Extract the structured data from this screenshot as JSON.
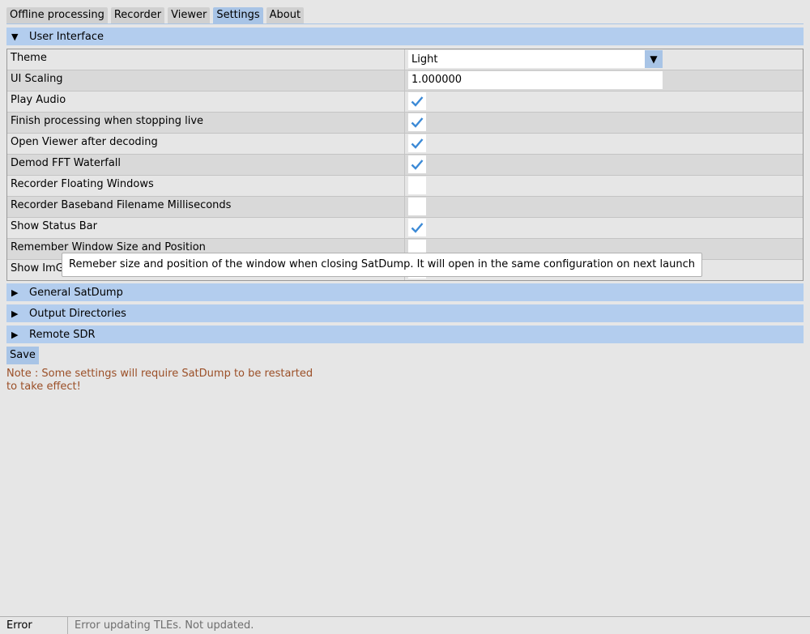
{
  "tabs": [
    {
      "label": "Offline processing",
      "active": false
    },
    {
      "label": "Recorder",
      "active": false
    },
    {
      "label": "Viewer",
      "active": false
    },
    {
      "label": "Settings",
      "active": true
    },
    {
      "label": "About",
      "active": false
    }
  ],
  "sections": {
    "user_interface": {
      "title": "User Interface",
      "expanded": true
    },
    "general": {
      "title": "General SatDump",
      "expanded": false
    },
    "output_dirs": {
      "title": "Output Directories",
      "expanded": false
    },
    "remote_sdr": {
      "title": "Remote SDR",
      "expanded": false
    }
  },
  "settings": {
    "theme": {
      "label": "Theme",
      "value": "Light"
    },
    "ui_scaling": {
      "label": "UI Scaling",
      "value": "1.000000"
    },
    "play_audio": {
      "label": "Play Audio",
      "checked": true
    },
    "finish_processing": {
      "label": "Finish processing when stopping live",
      "checked": true
    },
    "open_viewer": {
      "label": "Open Viewer after decoding",
      "checked": true
    },
    "demod_fft": {
      "label": "Demod FFT Waterfall",
      "checked": true
    },
    "floating_windows": {
      "label": "Recorder Floating Windows",
      "checked": false
    },
    "baseband_ms": {
      "label": "Recorder Baseband Filename Milliseconds",
      "checked": false
    },
    "status_bar": {
      "label": "Show Status Bar",
      "checked": true
    },
    "remember_window": {
      "label": "Remember Window Size and Position",
      "checked": false
    },
    "show_imgui": {
      "label": "Show ImG",
      "checked": false
    }
  },
  "tooltip": "Remeber size and position of the window when closing SatDump. It will open in the same configuration on next launch",
  "save_label": "Save",
  "note": "Note : Some settings will require SatDump to be restarted to take effect!",
  "status": {
    "label": "Error",
    "message": "Error updating TLEs. Not updated."
  },
  "colors": {
    "accent": "#b3cdee",
    "check": "#3c8ad6",
    "note": "#9b4f27"
  },
  "icons": {
    "expanded": "triangle-down-icon",
    "collapsed": "triangle-right-icon",
    "check": "checkmark-icon"
  }
}
